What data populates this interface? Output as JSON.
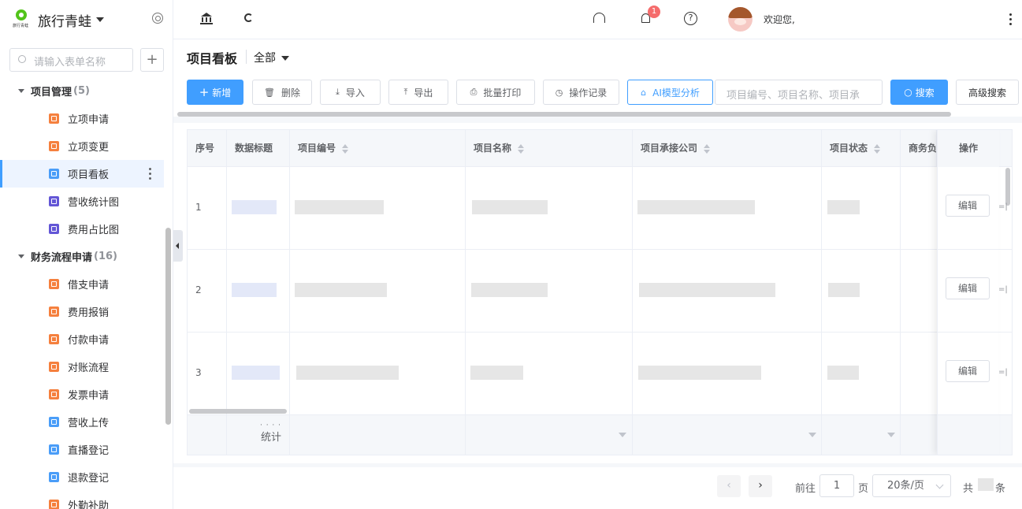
{
  "app": {
    "name": "旅行青蛙",
    "logo_text": "旅行青蛙"
  },
  "sidebar": {
    "search_placeholder": "请输入表单名称",
    "add_label": "+",
    "groups": [
      {
        "label": "项目管理",
        "count": "(5)",
        "items": [
          {
            "label": "立项申请",
            "icon_color": "#f5803e"
          },
          {
            "label": "立项变更",
            "icon_color": "#f5803e"
          },
          {
            "label": "项目看板",
            "icon_color": "#4a9df8",
            "active": true
          },
          {
            "label": "营收统计图",
            "icon_color": "#6356d6"
          },
          {
            "label": "费用占比图",
            "icon_color": "#6356d6"
          }
        ]
      },
      {
        "label": "财务流程申请",
        "count": "(16)",
        "items": [
          {
            "label": "借支申请",
            "icon_color": "#f5803e"
          },
          {
            "label": "费用报销",
            "icon_color": "#f5803e"
          },
          {
            "label": "付款申请",
            "icon_color": "#f5803e"
          },
          {
            "label": "对账流程",
            "icon_color": "#f5803e"
          },
          {
            "label": "发票申请",
            "icon_color": "#f5803e"
          },
          {
            "label": "营收上传",
            "icon_color": "#4a9df8"
          },
          {
            "label": "直播登记",
            "icon_color": "#4a9df8"
          },
          {
            "label": "退款登记",
            "icon_color": "#4a9df8"
          },
          {
            "label": "外勤补助",
            "icon_color": "#f5803e"
          }
        ]
      }
    ]
  },
  "header": {
    "notification_count": "1",
    "help_glyph": "?",
    "welcome": "欢迎您,"
  },
  "page": {
    "title": "项目看板",
    "filter": "全部"
  },
  "toolbar": {
    "new": "新增",
    "new_glyph": "+",
    "delete": "删除",
    "import": "导入",
    "export": "导出",
    "batch_print": "批量打印",
    "history": "操作记录",
    "ai": "AI模型分析",
    "search_placeholder": "项目编号、项目名称、项目承",
    "search": "搜索",
    "advanced": "高级搜索"
  },
  "table": {
    "columns": {
      "index": "序号",
      "data_title": "数据标题",
      "project_no": "项目编号",
      "project_name": "项目名称",
      "company": "项目承接公司",
      "status": "项目状态",
      "business": "商务负",
      "actions": "操作"
    },
    "rows": [
      {
        "index": "1",
        "edit": "编辑"
      },
      {
        "index": "2",
        "edit": "编辑"
      },
      {
        "index": "3",
        "edit": "编辑"
      }
    ],
    "footer": {
      "dots": "· · · ·",
      "label": "统计"
    },
    "edge_mark": "=|"
  },
  "pagination": {
    "prev": "‹",
    "next": "›",
    "goto_prefix": "前往",
    "page_value": "1",
    "goto_suffix": "页",
    "page_size": "20条/页",
    "total_prefix": "共",
    "total_suffix": "条"
  }
}
